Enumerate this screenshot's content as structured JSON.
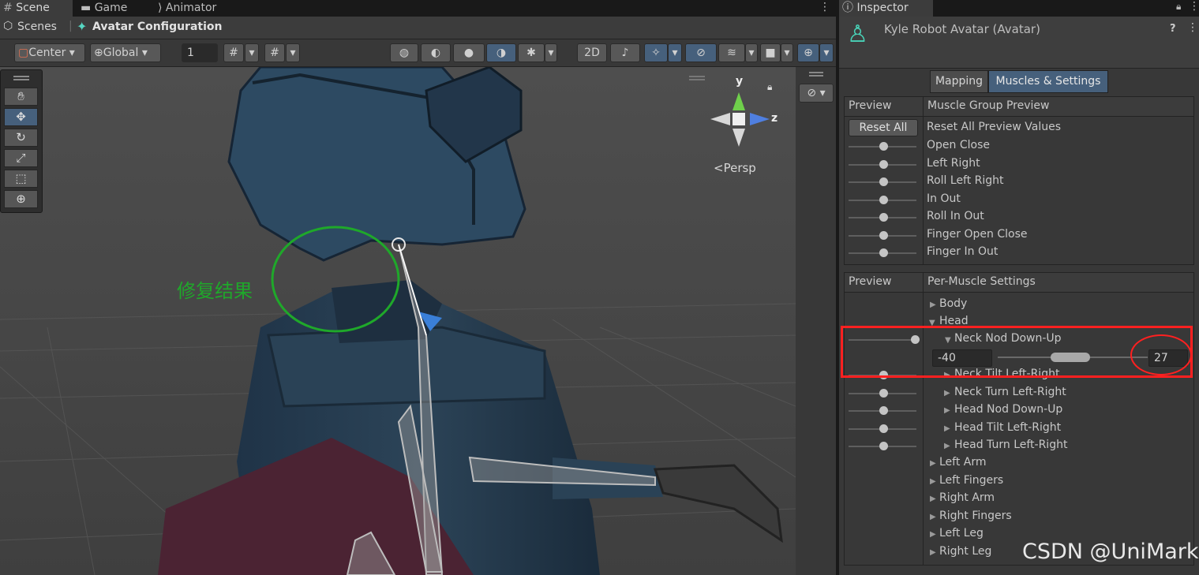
{
  "scene_tabs": [
    {
      "label": "Scene",
      "icon": "grid-icon"
    },
    {
      "label": "Game",
      "icon": "gamepad-icon"
    },
    {
      "label": "Animator",
      "icon": "animator-icon"
    }
  ],
  "breadcrumb": {
    "root": "Scenes",
    "current": "Avatar Configuration"
  },
  "toolbar": {
    "pivot": "Center",
    "space": "Global",
    "grid_value": "1",
    "mode_2d": "2D"
  },
  "viewport": {
    "projection": "Persp",
    "axis_y": "y",
    "axis_z": "z",
    "annotation": "修复结果",
    "annotation_color": "#1fa82a",
    "highlight_color": "#ff2020"
  },
  "inspector": {
    "tab": "Inspector",
    "title": "Kyle Robot Avatar (Avatar)",
    "mode_tabs": [
      "Mapping",
      "Muscles & Settings"
    ],
    "muscle_group": {
      "col_preview": "Preview",
      "col_title": "Muscle Group Preview",
      "reset_button": "Reset All",
      "reset_label": "Reset All Preview Values",
      "items": [
        "Open Close",
        "Left Right",
        "Roll Left Right",
        "In Out",
        "Roll In Out",
        "Finger Open Close",
        "Finger In Out"
      ]
    },
    "per_muscle": {
      "col_preview": "Preview",
      "col_title": "Per-Muscle Settings",
      "body": "Body",
      "head": "Head",
      "neck_nod": "Neck Nod Down-Up",
      "range_min": "-40",
      "range_max": "27",
      "head_children": [
        "Neck Tilt Left-Right",
        "Neck Turn Left-Right",
        "Head Nod Down-Up",
        "Head Tilt Left-Right",
        "Head Turn Left-Right"
      ],
      "groups": [
        "Left Arm",
        "Left Fingers",
        "Right Arm",
        "Right Fingers",
        "Left Leg",
        "Right Leg"
      ]
    }
  },
  "watermark": "CSDN @UniMark"
}
